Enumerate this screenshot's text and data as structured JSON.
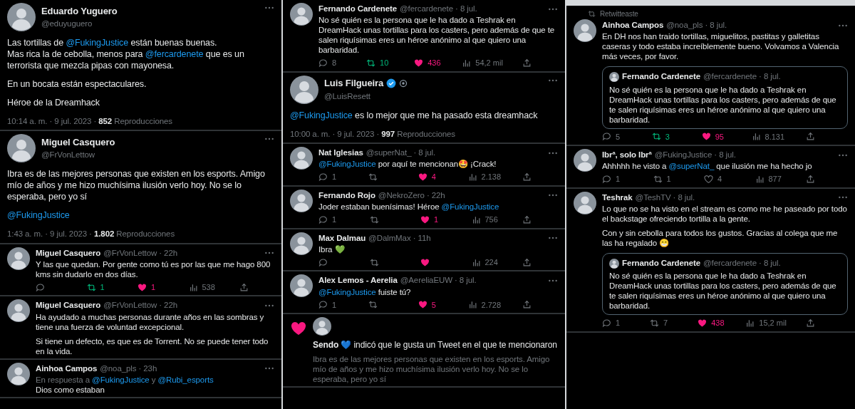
{
  "columns": [
    {
      "tweets": [
        {
          "kind": "detail",
          "name": "Eduardo Yuguero",
          "handle": "@eduyuguero",
          "body": [
            [
              {
                "kind": "text",
                "text": "Las tortillas de "
              },
              {
                "kind": "mention",
                "text": "@FukingJustice"
              },
              {
                "kind": "text",
                "text": " están buenas buenas.\nMas rica la de cebolla, menos para "
              },
              {
                "kind": "mention",
                "text": "@fercardenete"
              },
              {
                "kind": "text",
                "text": " que es un terrorista que mezcla pipas con mayonesa."
              }
            ],
            [
              {
                "kind": "text",
                "text": "En un bocata están espectaculares."
              }
            ],
            [
              {
                "kind": "text",
                "text": "Héroe de la Dreamhack"
              }
            ]
          ],
          "timestamp": "10:14 a. m. · 9 jul. 2023 · **852** Reproducciones"
        },
        {
          "kind": "detail",
          "name": "Miguel Casquero",
          "handle": "@FrVonLettow",
          "body": [
            [
              {
                "kind": "text",
                "text": "Ibra es de las mejores personas que existen en los esports. Amigo mío de años y me hizo muchísima ilusión verlo hoy. No se lo esperaba, pero yo sí"
              }
            ],
            [
              {
                "kind": "mention",
                "text": "@FukingJustice"
              }
            ]
          ],
          "timestamp": "1:43 a. m. · 9 jul. 2023 · **1.802** Reproducciones"
        },
        {
          "kind": "reply",
          "name": "Miguel Casquero",
          "meta": "@FrVonLettow · 22h",
          "body": [
            [
              {
                "kind": "text",
                "text": "Y las que quedan. Por gente como tú es por las que me hago 800 kms sin dudarlo en dos días."
              }
            ]
          ],
          "stats": {
            "retweets": "1",
            "retweeted": true,
            "likes": "1",
            "liked": true,
            "views": "538"
          }
        },
        {
          "kind": "reply",
          "name": "Miguel Casquero",
          "meta": "@FrVonLettow · 22h",
          "body": [
            [
              {
                "kind": "text",
                "text": "Ha ayudado a muchas personas durante años en las sombras y tiene una fuerza de voluntad excepcional."
              }
            ],
            [
              {
                "kind": "text",
                "text": "Si tiene un defecto, es que es de Torrent. No se puede tener todo en la vida."
              }
            ]
          ]
        },
        {
          "kind": "reply",
          "name": "Ainhoa Campos",
          "meta": "@noa_pls · 23h",
          "reply_to": [
            {
              "kind": "text",
              "text": "En respuesta a "
            },
            {
              "kind": "mention",
              "text": "@FukingJustice"
            },
            {
              "kind": "text",
              "text": " y "
            },
            {
              "kind": "mention",
              "text": "@Rubi_esports"
            }
          ],
          "body": [
            [
              {
                "kind": "text",
                "text": "Dios como estaban"
              }
            ]
          ]
        }
      ]
    },
    {
      "tweets": [
        {
          "kind": "reply",
          "name": "Fernando Cardenete",
          "meta": "@fercardenete · 8 jul.",
          "body": [
            [
              {
                "kind": "text",
                "text": "No sé quién es la persona que le ha dado a Teshrak en DreamHack unas tortillas para los casters, pero además de que te salen riquísimas eres un héroe anónimo al que quiero una barbaridad."
              }
            ]
          ],
          "stats": {
            "replies": "8",
            "retweets": "10",
            "retweeted": true,
            "likes": "436",
            "liked": true,
            "views": "54,2 mil"
          }
        },
        {
          "kind": "detail",
          "name": "Luis Filgueira",
          "handle": "@LuisResett",
          "verified": true,
          "body": [
            [
              {
                "kind": "mention",
                "text": "@FukingJustice"
              },
              {
                "kind": "text",
                "text": " es lo mejor que me ha pasado esta dreamhack"
              }
            ]
          ],
          "timestamp": "10:00 a. m. · 9 jul. 2023 · **997** Reproducciones"
        },
        {
          "kind": "reply",
          "name": "Nat Iglesias",
          "meta": "@superNat_ · 8 jul.",
          "body": [
            [
              {
                "kind": "mention",
                "text": "@FukingJustice"
              },
              {
                "kind": "text",
                "text": " por aquí te mencionan🤩 ¡Crack!"
              }
            ]
          ],
          "stats": {
            "replies": "1",
            "retweeted": false,
            "likes": "4",
            "liked": true,
            "views": "2.138"
          }
        },
        {
          "kind": "reply",
          "name": "Fernando Rojo",
          "meta": "@NekroZero · 22h",
          "body": [
            [
              {
                "kind": "text",
                "text": "Joder estaban buenísimas! Héroe "
              },
              {
                "kind": "mention",
                "text": "@FukingJustice"
              }
            ]
          ],
          "stats": {
            "replies": "1",
            "retweeted": false,
            "likes": "1",
            "liked": true,
            "views": "756"
          }
        },
        {
          "kind": "reply",
          "name": "Max Dalmau",
          "meta": "@DalmMax · 11h",
          "body": [
            [
              {
                "kind": "text",
                "text": "Ibra 💚"
              }
            ]
          ],
          "stats": {
            "retweeted": false,
            "liked": true,
            "views": "224"
          }
        },
        {
          "kind": "reply",
          "name": "Alex Lemos - Aerelia",
          "meta": "@AereliaEUW · 8 jul.",
          "body": [
            [
              {
                "kind": "mention",
                "text": "@FukingJustice"
              },
              {
                "kind": "text",
                "text": " fuiste tú?"
              }
            ]
          ],
          "stats": {
            "replies": "1",
            "retweeted": false,
            "likes": "5",
            "liked": true,
            "views": "2.728"
          }
        },
        {
          "kind": "like_notification",
          "text": "**Sendo** 💙 indicó que le gusta un Tweet en el que te mencionaron",
          "excerpt": "Ibra es de las mejores personas que existen en los esports. Amigo mío de años y me hizo muchísima ilusión verlo hoy. No se lo esperaba, pero yo sí"
        }
      ]
    },
    {
      "tweets": [
        {
          "kind": "reply",
          "retweet_header": "Retwitteaste",
          "name": "Ainhoa Campos",
          "meta": "@noa_pls · 8 jul.",
          "body": [
            [
              {
                "kind": "text",
                "text": "En DH nos han traido tortillas, miguelitos, pastitas y galletitas caseras y todo estaba increíblemente bueno. Volvamos a Valencia más veces, por favor."
              }
            ]
          ],
          "quote": {
            "name": "Fernando Cardenete",
            "meta": "@fercardenete · 8 jul.",
            "text": "No sé quién es la persona que le ha dado a Teshrak en DreamHack unas tortillas para los casters, pero además de que te salen riquísimas eres un héroe anónimo al que quiero una barbaridad."
          },
          "stats": {
            "replies": "5",
            "retweets": "3",
            "retweeted": true,
            "likes": "95",
            "liked": true,
            "views": "8.131"
          }
        },
        {
          "kind": "reply",
          "name": "Ibrª, solo Ibrª",
          "meta": "@FukingJustice · 8 jul.",
          "body": [
            [
              {
                "kind": "text",
                "text": "Ahhhhh he visto a "
              },
              {
                "kind": "mention",
                "text": "@superNat_"
              },
              {
                "kind": "text",
                "text": " que ilusión me ha hecho jo"
              }
            ]
          ],
          "stats": {
            "replies": "1",
            "retweets": "1",
            "retweeted": false,
            "likes": "4",
            "liked": false,
            "views": "877"
          }
        },
        {
          "kind": "reply",
          "name": "Teshrak",
          "meta": "@TeshTV · 8 jul.",
          "body": [
            [
              {
                "kind": "text",
                "text": "Lo que no se ha visto en el stream es como me he paseado por todo el backstage ofreciendo tortilla a la gente."
              }
            ],
            [
              {
                "kind": "text",
                "text": "Con y sin cebolla para todos los gustos. Gracias al colega que me las ha regalado 😁"
              }
            ]
          ],
          "quote": {
            "name": "Fernando Cardenete",
            "meta": "@fercardenete · 8 jul.",
            "text": "No sé quién es la persona que le ha dado a Teshrak en DreamHack unas tortillas para los casters, pero además de que te salen riquísimas eres un héroe anónimo al que quiero una barbaridad."
          },
          "stats": {
            "replies": "1",
            "retweets": "7",
            "retweeted": false,
            "likes": "438",
            "liked": true,
            "views": "15,2 mil"
          }
        }
      ]
    }
  ]
}
